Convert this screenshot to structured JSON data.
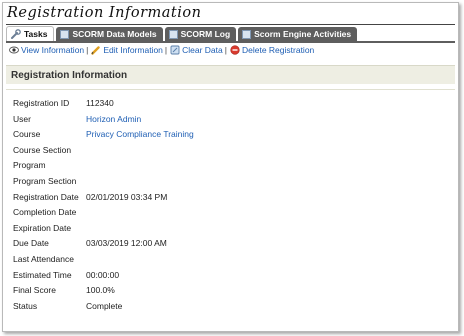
{
  "page": {
    "title": "Registration Information"
  },
  "tabs": [
    {
      "label": "Tasks",
      "active": true,
      "icon": "wrench-icon"
    },
    {
      "label": "SCORM Data Models",
      "active": false,
      "icon": "table-icon"
    },
    {
      "label": "SCORM Log",
      "active": false,
      "icon": "table-icon"
    },
    {
      "label": "Scorm Engine Activities",
      "active": false,
      "icon": "table-icon"
    }
  ],
  "toolbar": {
    "view": "View Information",
    "edit": "Edit Information",
    "clear": "Clear Data",
    "delete": "Delete Registration",
    "separator": "|"
  },
  "section": {
    "title": "Registration Information"
  },
  "fields": [
    {
      "label": "Registration ID",
      "value": "112340"
    },
    {
      "label": "User",
      "value": "Horizon Admin"
    },
    {
      "label": "Course",
      "value": "Privacy Compliance Training"
    },
    {
      "label": "Course Section",
      "value": ""
    },
    {
      "label": "Program",
      "value": ""
    },
    {
      "label": "Program Section",
      "value": ""
    },
    {
      "label": "Registration Date",
      "value": "02/01/2019 03:34 PM"
    },
    {
      "label": "Completion Date",
      "value": ""
    },
    {
      "label": "Expiration Date",
      "value": ""
    },
    {
      "label": "Due Date",
      "value": "03/03/2019 12:00 AM"
    },
    {
      "label": "Last Attendance",
      "value": ""
    },
    {
      "label": "Estimated Time",
      "value": "00:00:00"
    },
    {
      "label": "Final Score",
      "value": "100.0%"
    },
    {
      "label": "Status",
      "value": "Complete"
    }
  ],
  "colors": {
    "link": "#1f5fb4",
    "tab_inactive": "#5e5e5e",
    "panel": "#eeeee3"
  }
}
